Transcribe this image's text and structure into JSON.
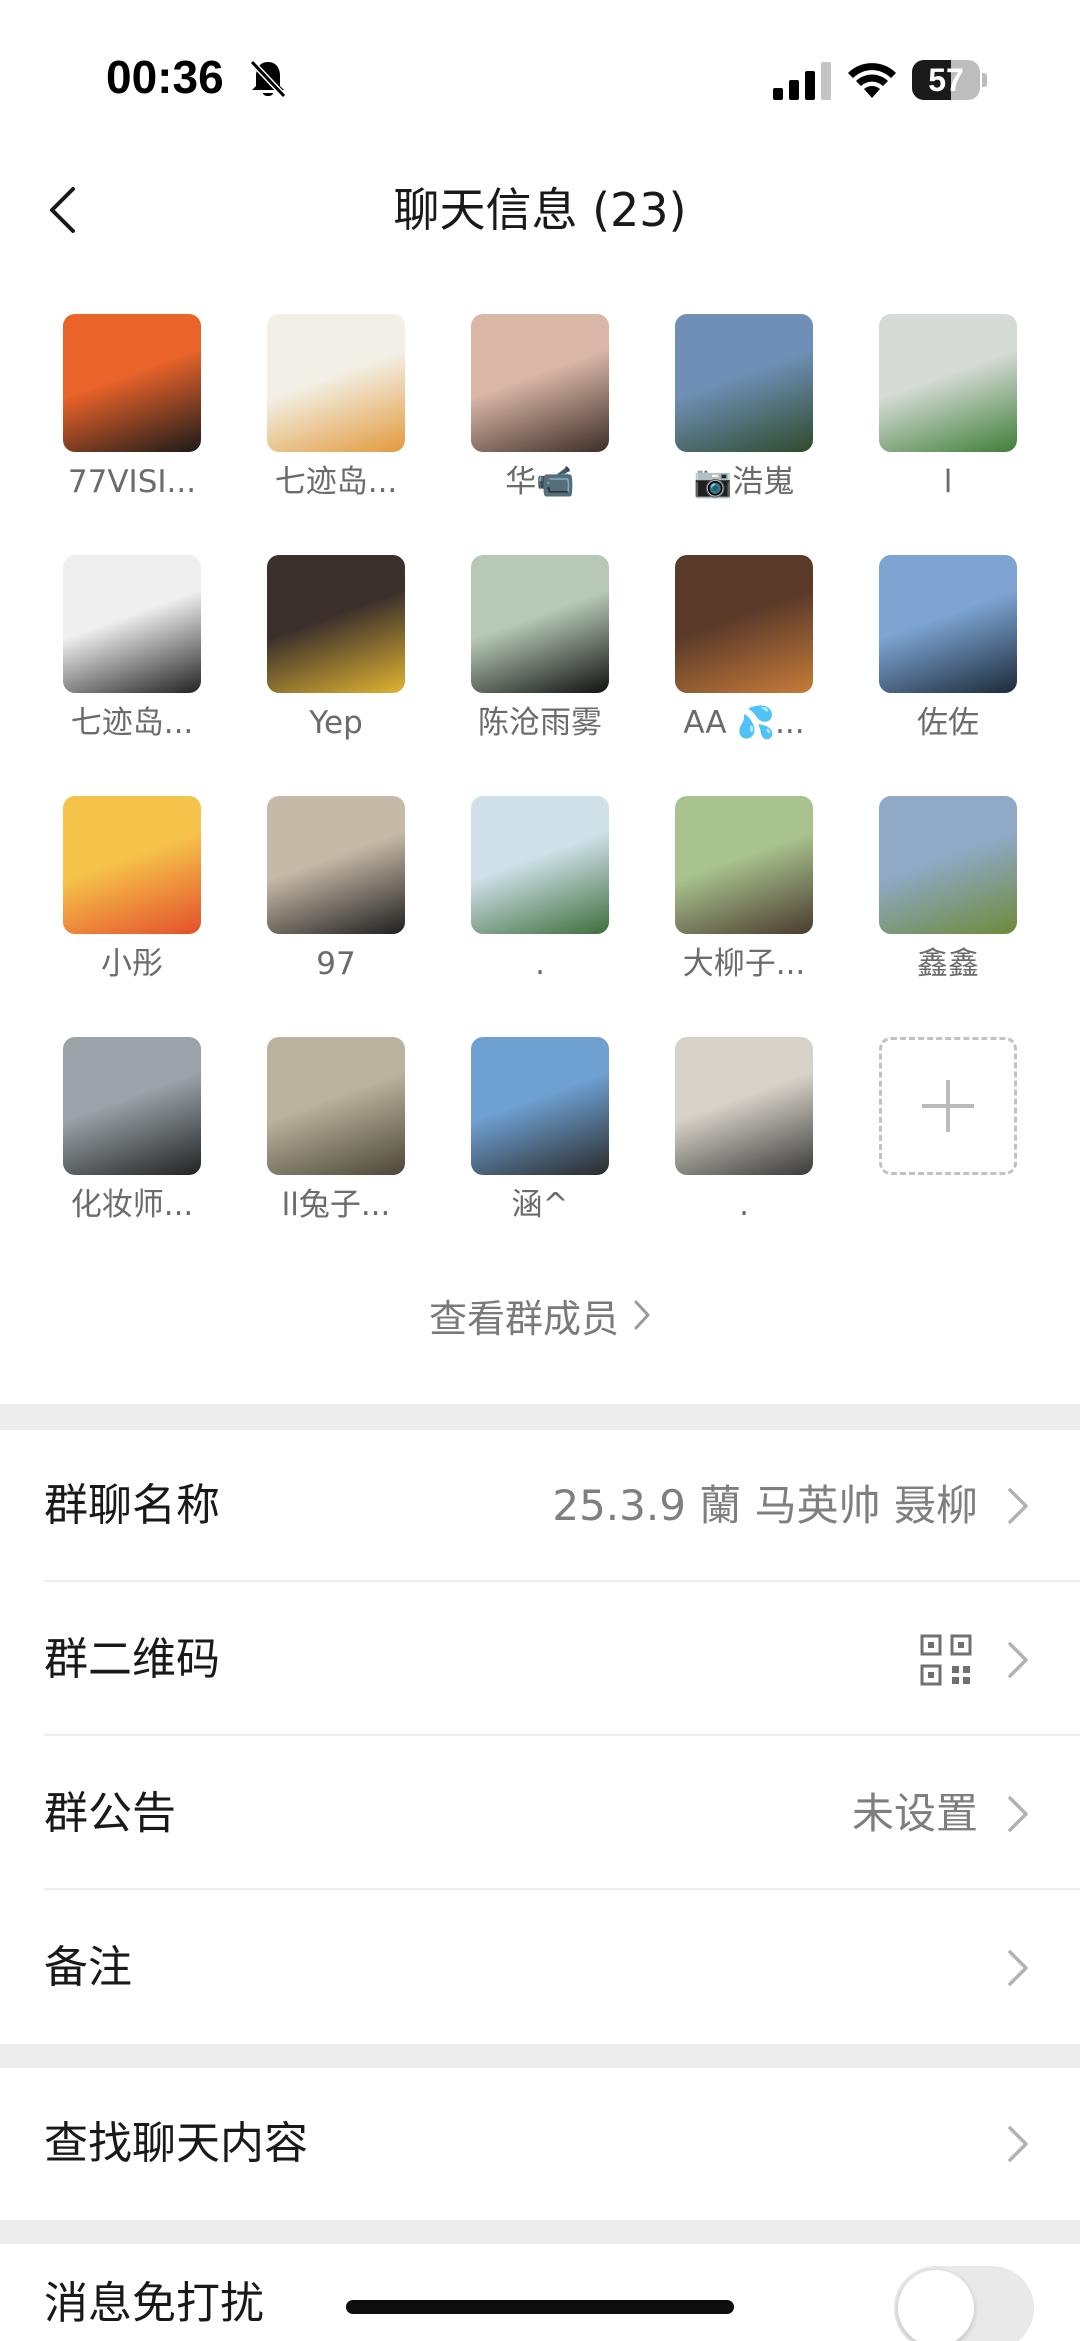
{
  "status_bar": {
    "time": "00:36",
    "battery_level": "57",
    "battery_fraction": 0.57
  },
  "nav": {
    "title": "聊天信息 (23)"
  },
  "members": [
    {
      "name": "77VISI...",
      "color1": "#e9632a",
      "color2": "#1a1a1a"
    },
    {
      "name": "七迹岛...",
      "color1": "#f2f0e6",
      "color2": "#e39a3d"
    },
    {
      "name": "华📹",
      "color1": "#d9b6a6",
      "color2": "#3c2d29"
    },
    {
      "name": "📷浩嵬",
      "color1": "#6f8fb6",
      "color2": "#2f4a2c"
    },
    {
      "name": "l",
      "color1": "#d6dbd7",
      "color2": "#3f7f37"
    },
    {
      "name": "七迹岛...",
      "color1": "#efefef",
      "color2": "#222222"
    },
    {
      "name": "Yep",
      "color1": "#3b302b",
      "color2": "#e1b432"
    },
    {
      "name": "陈沧雨雾",
      "color1": "#b7c9b6",
      "color2": "#111111"
    },
    {
      "name": "AA 💦...",
      "color1": "#5b3a2a",
      "color2": "#c77c3a"
    },
    {
      "name": "佐佐",
      "color1": "#7da4d2",
      "color2": "#1c2a3a"
    },
    {
      "name": "小彤",
      "color1": "#f6c34a",
      "color2": "#e44f2c"
    },
    {
      "name": "97",
      "color1": "#c6b9a8",
      "color2": "#1f1f1f"
    },
    {
      "name": ".",
      "color1": "#cfe0e9",
      "color2": "#3e6e3b"
    },
    {
      "name": "大柳子...",
      "color1": "#a9c38f",
      "color2": "#4a3a2e"
    },
    {
      "name": "鑫鑫",
      "color1": "#8fa9c6",
      "color2": "#6e8a3a"
    },
    {
      "name": "化妆师...",
      "color1": "#9aa3a8",
      "color2": "#222222"
    },
    {
      "name": "ll兔子...",
      "color1": "#b7b39d",
      "color2": "#4b4637"
    },
    {
      "name": "涵^",
      "color1": "#6ea0d2",
      "color2": "#2a2a2a"
    },
    {
      "name": ".",
      "color1": "#d7d2c8",
      "color2": "#3a3a3a"
    }
  ],
  "view_members": {
    "label": "查看群成员"
  },
  "settings": {
    "group_name": {
      "label": "群聊名称",
      "value": "25.3.9 蘭 马英帅 聂柳"
    },
    "group_qr": {
      "label": "群二维码"
    },
    "announcement": {
      "label": "群公告",
      "value": "未设置"
    },
    "remark": {
      "label": "备注"
    },
    "search_chat": {
      "label": "查找聊天内容"
    },
    "mute": {
      "label": "消息免打扰",
      "enabled": false
    }
  }
}
